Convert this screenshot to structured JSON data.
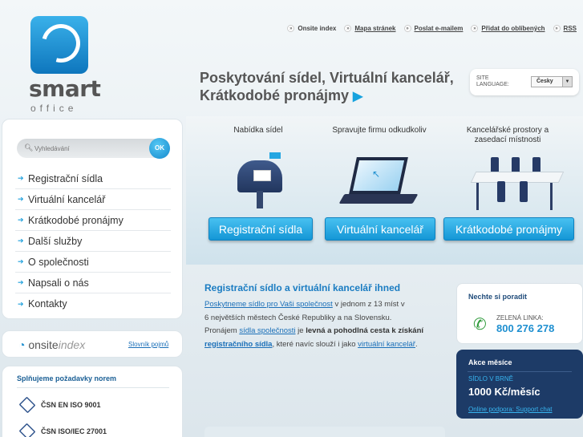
{
  "logo": {
    "word1": "smart",
    "word2": "office"
  },
  "top_links": [
    {
      "label": "Onsite index",
      "link": false
    },
    {
      "label": "Mapa stránek",
      "link": true
    },
    {
      "label": "Poslat e-mailem",
      "link": true
    },
    {
      "label": "Přidat do oblíbených",
      "link": true
    },
    {
      "label": "RSS",
      "link": true
    }
  ],
  "headline": {
    "line1": "Poskytování sídel, Virtuální kancelář,",
    "line2": "Krátkodobé pronájmy",
    "arrow": "▶"
  },
  "language": {
    "label_line1": "SITE",
    "label_line2": "LANGUAGE:",
    "selected": "Česky",
    "chevron": "▼"
  },
  "search": {
    "placeholder": "Vyhledávání",
    "button": "OK",
    "icon": "search-icon"
  },
  "nav": {
    "arrow": "➔",
    "items": [
      "Registrační sídla",
      "Virtuální kancelář",
      "Krátkodobé pronájmy",
      "Další služby",
      "O společnosti",
      "Napsali o nás",
      "Kontakty"
    ]
  },
  "onsite": {
    "brand_a": "onsite",
    "brand_b": "index",
    "link": "Slovník pojmů"
  },
  "norms": {
    "title": "Splňujeme požadavky norem",
    "items": [
      "ČSN EN ISO 9001",
      "ČSN ISO/IEC 27001"
    ]
  },
  "features": [
    {
      "title": "Nabídka sídel",
      "button": "Registrační sídla"
    },
    {
      "title": "Spravujte firmu odkudkoliv",
      "button": "Virtuální kancelář"
    },
    {
      "title_line1": "Kancelářské prostory a",
      "title_line2": "zasedací místnosti",
      "button": "Krátkodobé pronájmy"
    }
  ],
  "content": {
    "title": "Registrační sídlo a virtuální kancelář ihned",
    "p1_link": "Poskytneme sídlo pro Vaši společnost",
    "p1_rest": " v jednom z 13 míst v",
    "p2": "6 největších městech České Republiky a na Slovensku.",
    "p3_a": "Pronájem ",
    "p3_link": "sídla společnosti",
    "p3_b": " je ",
    "p3_bold": "levná a pohodlná cesta k získání",
    "p4_link": "registračního sídla",
    "p4_rest": ", které navíc slouží i jako ",
    "p4_link2": "virtuální kancelář",
    "p4_end": "."
  },
  "advice": {
    "title": "Nechte si poradit",
    "green_label": "ZELENÁ LINKA:",
    "number": "800 276 278",
    "icon": "phone-icon"
  },
  "promo": {
    "title": "Akce měsíce",
    "subtitle": "SÍDLO V BRNĚ",
    "price": "1000 Kč/měsíc",
    "link": "Online podpora: Support chat"
  }
}
